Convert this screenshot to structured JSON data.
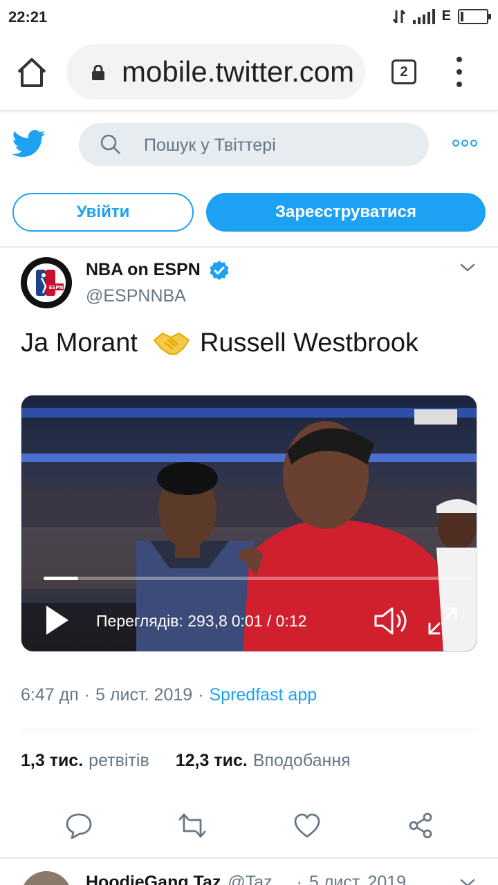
{
  "status_bar": {
    "time": "22:21",
    "network": "E"
  },
  "browser": {
    "url": "mobile.twitter.com",
    "tab_count": "2"
  },
  "header": {
    "search_placeholder": "Пошук у Твіттері"
  },
  "auth": {
    "login_label": "Увійти",
    "signup_label": "Зареєструватися"
  },
  "tweet": {
    "author_name": "NBA on ESPN",
    "author_handle": "@ESPNNBA",
    "text_left": "Ja Morant",
    "text_right": "Russell Westbrook",
    "video": {
      "views_label": "Переглядів: 293,8",
      "time": "0:01 / 0:12",
      "progress": 0.08
    },
    "time": "6:47 дп",
    "date": "5 лист. 2019",
    "separator": "·",
    "source": "Spredfast app",
    "retweets_count": "1,3 тис.",
    "retweets_label": "ретвітів",
    "likes_count": "12,3 тис.",
    "likes_label": "Вподобання"
  },
  "next_tweet": {
    "author_name": "HoodieGang Taz",
    "handle": "@Taz…",
    "separator": "·",
    "date": "5 лист. 2019"
  },
  "colors": {
    "twitter_blue": "#1da1f2",
    "gray_text": "#657786",
    "dark_text": "#14171a"
  },
  "icons": [
    "home-icon",
    "lock-icon",
    "tabs-icon",
    "overflow-menu-icon",
    "twitter-bird-icon",
    "search-icon",
    "more-dots-icon",
    "verified-icon",
    "chevron-down-icon",
    "handshake-emoji-icon",
    "play-icon",
    "volume-icon",
    "fullscreen-icon",
    "reply-icon",
    "retweet-icon",
    "like-icon",
    "share-icon"
  ]
}
